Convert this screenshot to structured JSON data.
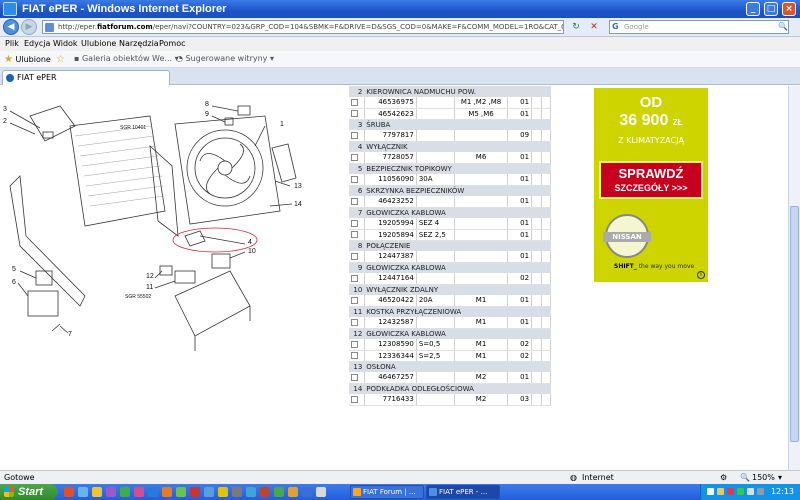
{
  "window": {
    "title": "FIAT ePER - Windows Internet Explorer",
    "min": "_",
    "max": "□",
    "close": "×"
  },
  "address": {
    "url_prefix": "http://eper.",
    "url_domain": "fiatforum.com",
    "url_rest": "/eper/navi?COUNTRY=023&GRP_COD=104&SBMK=F&DRIVE=D&SGS_COD=0&MAKE=F&COMM_MODEL=1RO&CAT_CO",
    "back": "◀",
    "forward": "▶",
    "refresh": "↻",
    "stop": "✕",
    "search_placeholder": "Google",
    "search_g": "G"
  },
  "menu": [
    "Plik",
    "Edycja",
    "Widok",
    "Ulubione",
    "Narzędzia",
    "Pomoc"
  ],
  "favbar": {
    "favorites": "Ulubione",
    "gallery": "Galeria obiektów We...",
    "suggested": "Sugerowane witryny"
  },
  "tab": {
    "title": "FIAT ePER"
  },
  "diagram": {
    "labels": [
      "3",
      "2",
      "8",
      "9",
      "1",
      "13",
      "14",
      "4",
      "10",
      "5",
      "6",
      "12",
      "11",
      "7"
    ],
    "ref1": "SGR 10401",
    "ref2": "SGR 55502"
  },
  "parts": [
    {
      "type": "group",
      "num": "2",
      "name": "KIEROWNICA NADMUCHU POW."
    },
    {
      "type": "row",
      "code": "46536975",
      "note": "",
      "model": "M1 ,M2 ,M8",
      "qty": "01"
    },
    {
      "type": "row",
      "code": "46542623",
      "note": "",
      "model": "M5 ,M6",
      "qty": "01"
    },
    {
      "type": "group",
      "num": "3",
      "name": "ŚRUBA"
    },
    {
      "type": "row",
      "code": "7797817",
      "note": "",
      "model": "",
      "qty": "09"
    },
    {
      "type": "group",
      "num": "4",
      "name": "WYŁĄCZNIK"
    },
    {
      "type": "row",
      "code": "7728057",
      "note": "",
      "model": "M6",
      "qty": "01"
    },
    {
      "type": "group",
      "num": "5",
      "name": "BEZPIECZNIK TOPIKOWY"
    },
    {
      "type": "row",
      "code": "11056090",
      "note": "30A",
      "model": "",
      "qty": "01"
    },
    {
      "type": "group",
      "num": "6",
      "name": "SKRZYNKA BEZPIECZNIKÓW"
    },
    {
      "type": "row",
      "code": "46423252",
      "note": "",
      "model": "",
      "qty": "01"
    },
    {
      "type": "group",
      "num": "7",
      "name": "GŁOWICZKA KABLOWA"
    },
    {
      "type": "row",
      "code": "19205994",
      "note": "SEZ 4",
      "model": "",
      "qty": "01"
    },
    {
      "type": "row",
      "code": "19205894",
      "note": "SEZ 2,5",
      "model": "",
      "qty": "01"
    },
    {
      "type": "group",
      "num": "8",
      "name": "POŁĄCZENIE"
    },
    {
      "type": "row",
      "code": "12447387",
      "note": "",
      "model": "",
      "qty": "01"
    },
    {
      "type": "group",
      "num": "9",
      "name": "GŁOWICZKA KABLOWA"
    },
    {
      "type": "row",
      "code": "12447164",
      "note": "",
      "model": "",
      "qty": "02"
    },
    {
      "type": "group",
      "num": "10",
      "name": "WYŁĄCZNIK ZDALNY"
    },
    {
      "type": "row",
      "code": "46520422",
      "note": "20A",
      "model": "M1",
      "qty": "01"
    },
    {
      "type": "group",
      "num": "11",
      "name": "KOSTKA PRZYŁĄCZENIOWA"
    },
    {
      "type": "row",
      "code": "12432587",
      "note": "",
      "model": "M1",
      "qty": "01"
    },
    {
      "type": "group",
      "num": "12",
      "name": "GŁOWICZKA KABLOWA"
    },
    {
      "type": "row",
      "code": "12308590",
      "note": "S=0,5",
      "model": "M1",
      "qty": "02"
    },
    {
      "type": "row",
      "code": "12336344",
      "note": "S=2,5",
      "model": "M1",
      "qty": "02"
    },
    {
      "type": "group",
      "num": "13",
      "name": "OSŁONA"
    },
    {
      "type": "row",
      "code": "46467257",
      "note": "",
      "model": "M2",
      "qty": "01"
    },
    {
      "type": "group",
      "num": "14",
      "name": "PODKŁADKA ODLEGŁOŚCIOWA"
    },
    {
      "type": "row",
      "code": "7716433",
      "note": "",
      "model": "M2",
      "qty": "03"
    }
  ],
  "ad": {
    "price_line1": "OD",
    "price_line2": "36 900",
    "currency": "ZŁ",
    "promo": "Z KLIMATYZACJĄ",
    "cta_line1": "SPRAWDŹ",
    "cta_line2": "SZCZEGÓŁY >>>",
    "brand": "NISSAN",
    "slogan_bold": "SHIFT_",
    "slogan": "the way you move",
    "info": "i"
  },
  "status": {
    "left": "Gotowe",
    "zone": "Internet",
    "zoom": "150%"
  },
  "taskbar": {
    "start": "Start",
    "buttons": [
      "FIAT Forum | ...",
      "FIAT ePER - ..."
    ],
    "clock": "12:13"
  }
}
